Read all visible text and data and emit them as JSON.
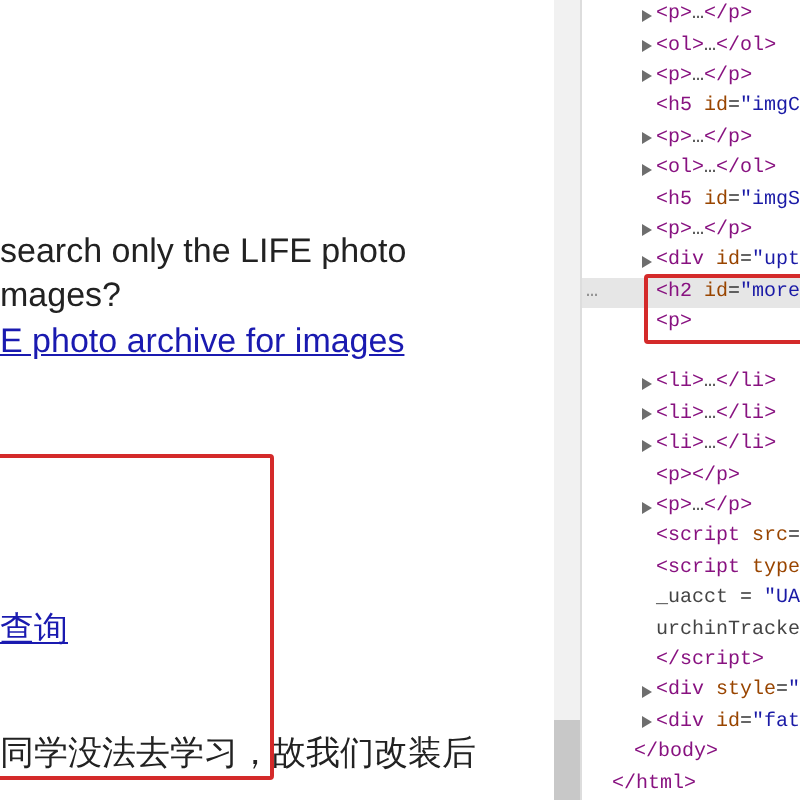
{
  "page": {
    "paragraph_lines": [
      "search only the LIFE photo",
      "mages?"
    ],
    "archive_link": "E photo archive for images",
    "query_link": "查询",
    "body_text": "同学没法去学习，故我们改装后"
  },
  "elements": [
    {
      "kind": "child",
      "arrow": true,
      "text": "<p>…</p>",
      "selected": false
    },
    {
      "kind": "child",
      "arrow": true,
      "text": "<ol>…</ol>",
      "selected": false
    },
    {
      "kind": "child",
      "arrow": true,
      "text": "<p>…</p>",
      "selected": false
    },
    {
      "kind": "child",
      "arrow": false,
      "text": "<h5 id=\"imgC",
      "selected": false
    },
    {
      "kind": "child",
      "arrow": true,
      "text": "<p>…</p>",
      "selected": false
    },
    {
      "kind": "child",
      "arrow": true,
      "text": "<ol>…</ol>",
      "selected": false
    },
    {
      "kind": "child",
      "arrow": false,
      "text": "<h5 id=\"imgS",
      "selected": false
    },
    {
      "kind": "child",
      "arrow": true,
      "text": "<p>…</p>",
      "selected": false
    },
    {
      "kind": "child",
      "arrow": true,
      "text": "<div id=\"upt",
      "selected": false
    },
    {
      "kind": "child",
      "arrow": false,
      "text": "<h2 id=\"more",
      "selected": true,
      "more": "…"
    },
    {
      "kind": "child",
      "arrow": false,
      "text": "<p>",
      "selected": false
    },
    {
      "kind": "child",
      "arrow": true,
      "text": "<li>…</li>",
      "selected": false
    },
    {
      "kind": "child",
      "arrow": true,
      "text": "<li>…</li>",
      "selected": false
    },
    {
      "kind": "child",
      "arrow": true,
      "text": "<li>…</li>",
      "selected": false
    },
    {
      "kind": "child",
      "arrow": false,
      "text": "<p></p>",
      "selected": false
    },
    {
      "kind": "child",
      "arrow": true,
      "text": "<p>…</p>",
      "selected": false
    },
    {
      "kind": "child",
      "arrow": false,
      "text": "<script src=",
      "selected": false
    },
    {
      "kind": "child",
      "arrow": false,
      "text": "<script type",
      "selected": false
    },
    {
      "kind": "script-text",
      "arrow": false,
      "text": "_uacct = \"UA",
      "selected": false
    },
    {
      "kind": "script-text",
      "arrow": false,
      "text": "urchinTracke",
      "selected": false
    },
    {
      "kind": "child",
      "arrow": false,
      "text": "</script>",
      "selected": false
    },
    {
      "kind": "child",
      "arrow": true,
      "text": "<div style=\"",
      "selected": false
    },
    {
      "kind": "child",
      "arrow": true,
      "text": "<div id=\"fat",
      "selected": false
    },
    {
      "kind": "body-close",
      "arrow": false,
      "text": "</body>",
      "selected": false
    },
    {
      "kind": "html-close",
      "arrow": false,
      "text": "</html>",
      "selected": false
    }
  ]
}
